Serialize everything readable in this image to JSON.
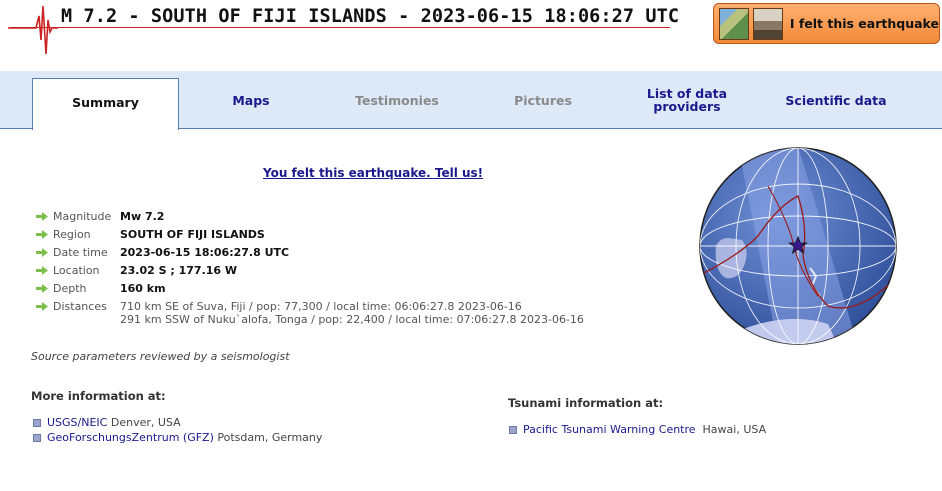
{
  "header": {
    "title": "M 7.2 - SOUTH OF FIJI ISLANDS - 2023-06-15 18:06:27 UTC",
    "felt_button_label": "I felt this earthquake"
  },
  "tabs": [
    {
      "label": "Summary",
      "state": "active"
    },
    {
      "label": "Maps",
      "state": "link"
    },
    {
      "label": "Testimonies",
      "state": "disabled"
    },
    {
      "label": "Pictures",
      "state": "disabled"
    },
    {
      "label": "List of data providers",
      "state": "link"
    },
    {
      "label": "Scientific data",
      "state": "link"
    }
  ],
  "felt_link": "You felt this earthquake. Tell us!",
  "parameters": [
    {
      "label": "Magnitude",
      "value": "Mw 7.2"
    },
    {
      "label": "Region",
      "value": "SOUTH OF FIJI ISLANDS"
    },
    {
      "label": "Date time",
      "value": "2023-06-15 18:06:27.8 UTC"
    },
    {
      "label": "Location",
      "value": "23.02 S ; 177.16 W"
    },
    {
      "label": "Depth",
      "value": "160 km"
    }
  ],
  "distances": {
    "label": "Distances",
    "lines": [
      "710 km SE of Suva, Fiji / pop: 77,300 / local time: 06:06:27.8 2023-06-16",
      "291 km SSW of Nuku`alofa, Tonga / pop: 22,400 / local time: 07:06:27.8 2023-06-16"
    ]
  },
  "review_note": "Source parameters reviewed by a seismologist",
  "more_info": {
    "title": "More information at:",
    "links": [
      {
        "link": "USGS/NEIC",
        "rest": " Denver, USA"
      },
      {
        "link": "GeoForschungsZentrum (GFZ)",
        "rest": " Potsdam, Germany"
      }
    ]
  },
  "tsunami_info": {
    "title": "Tsunami information at:",
    "links": [
      {
        "link": "Pacific Tsunami Warning Centre",
        "rest": "  Hawai, USA"
      }
    ]
  },
  "colors": {
    "accent_link": "#1a1a8c",
    "tab_bar": "#dde9f6",
    "felt_button": "#f38a3a",
    "title_line": "#cc2222",
    "epicenter_marker": "#3a1a8c"
  },
  "icons": [
    "seismogram-logo-icon",
    "map-thumbnail-icon",
    "photo-thumbnail-icon",
    "green-arrow-icon",
    "bullet-icon",
    "globe-map",
    "epicenter-star-icon"
  ]
}
